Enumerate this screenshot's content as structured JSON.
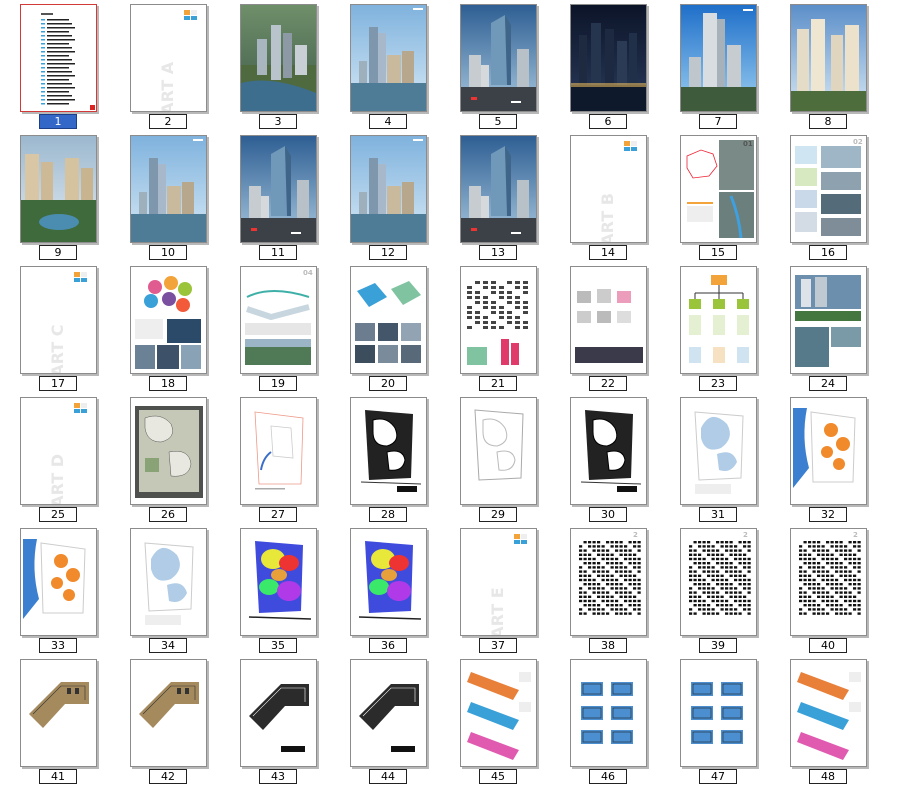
{
  "window": {
    "title": ""
  },
  "selected_page": 1,
  "pages": [
    {
      "label": "1",
      "kind": "index"
    },
    {
      "label": "2",
      "kind": "part",
      "part_text": "PART A"
    },
    {
      "label": "3",
      "kind": "aerial"
    },
    {
      "label": "4",
      "kind": "river"
    },
    {
      "label": "5",
      "kind": "tower"
    },
    {
      "label": "6",
      "kind": "night"
    },
    {
      "label": "7",
      "kind": "tall"
    },
    {
      "label": "8",
      "kind": "residential"
    },
    {
      "label": "9",
      "kind": "garden"
    },
    {
      "label": "10",
      "kind": "river"
    },
    {
      "label": "11",
      "kind": "tower"
    },
    {
      "label": "12",
      "kind": "river"
    },
    {
      "label": "13",
      "kind": "tower"
    },
    {
      "label": "14",
      "kind": "part",
      "part_text": "PART B"
    },
    {
      "label": "15",
      "kind": "mapsheet"
    },
    {
      "label": "16",
      "kind": "collage"
    },
    {
      "label": "17",
      "kind": "part",
      "part_text": "PART C"
    },
    {
      "label": "18",
      "kind": "circles"
    },
    {
      "label": "19",
      "kind": "sections"
    },
    {
      "label": "20",
      "kind": "diagram"
    },
    {
      "label": "21",
      "kind": "calligraphy"
    },
    {
      "label": "22",
      "kind": "concept"
    },
    {
      "label": "23",
      "kind": "tree"
    },
    {
      "label": "24",
      "kind": "photos"
    },
    {
      "label": "25",
      "kind": "part",
      "part_text": "PART D"
    },
    {
      "label": "26",
      "kind": "siteplan"
    },
    {
      "label": "27",
      "kind": "lightplan"
    },
    {
      "label": "28",
      "kind": "blackplan"
    },
    {
      "label": "29",
      "kind": "greyplan"
    },
    {
      "label": "30",
      "kind": "blackplan"
    },
    {
      "label": "31",
      "kind": "blueplan"
    },
    {
      "label": "32",
      "kind": "orangeplan"
    },
    {
      "label": "33",
      "kind": "orangeplan"
    },
    {
      "label": "34",
      "kind": "blueplan"
    },
    {
      "label": "35",
      "kind": "heatmap"
    },
    {
      "label": "36",
      "kind": "heatmap"
    },
    {
      "label": "37",
      "kind": "part",
      "part_text": "PART E"
    },
    {
      "label": "38",
      "kind": "dense"
    },
    {
      "label": "39",
      "kind": "dense"
    },
    {
      "label": "40",
      "kind": "dense"
    },
    {
      "label": "41",
      "kind": "floorcolor"
    },
    {
      "label": "42",
      "kind": "floorcolor"
    },
    {
      "label": "43",
      "kind": "floorblack"
    },
    {
      "label": "44",
      "kind": "floorblack"
    },
    {
      "label": "45",
      "kind": "units"
    },
    {
      "label": "46",
      "kind": "unitgrid"
    },
    {
      "label": "47",
      "kind": "unitgrid"
    },
    {
      "label": "48",
      "kind": "units"
    }
  ]
}
